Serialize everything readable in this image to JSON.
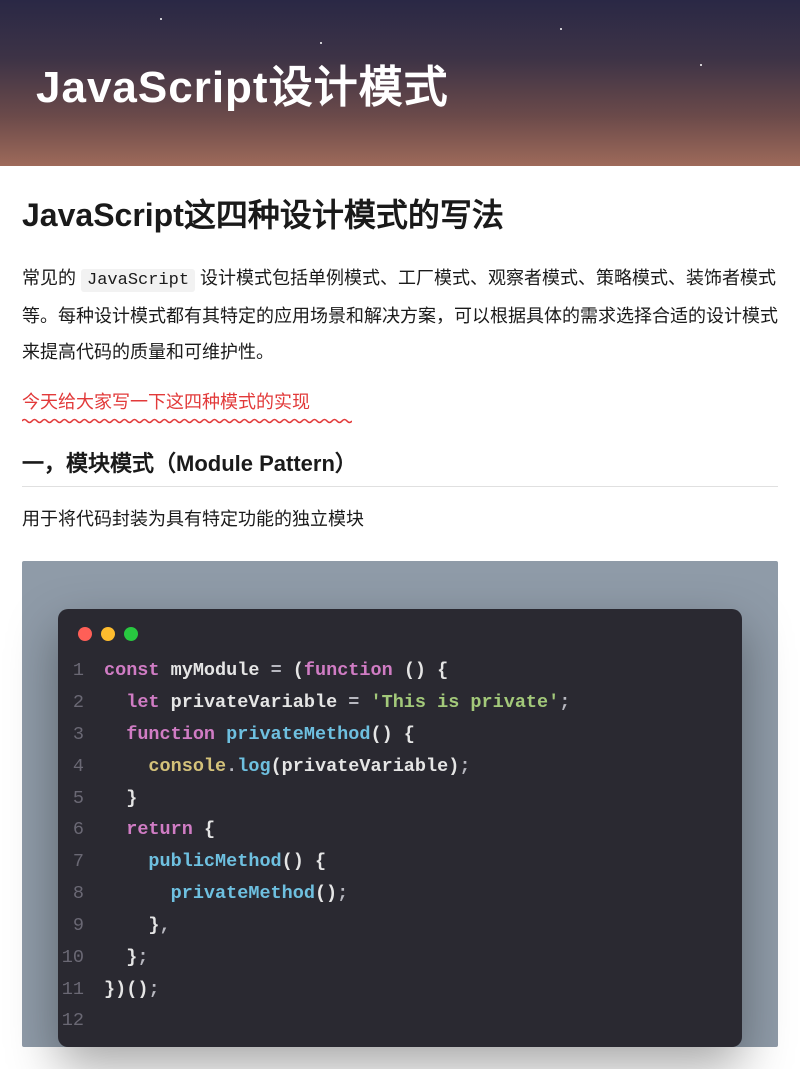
{
  "hero": {
    "title": "JavaScript设计模式"
  },
  "article": {
    "title": "JavaScript这四种设计模式的写法",
    "intro_pre": "常见的 ",
    "intro_code": "JavaScript",
    "intro_post": " 设计模式包括单例模式、工厂模式、观察者模式、策略模式、装饰者模式等。每种设计模式都有其特定的应用场景和解决方案，可以根据具体的需求选择合适的设计模式来提高代码的质量和可维护性。",
    "highlight": "今天给大家写一下这四种模式的实现"
  },
  "section1": {
    "heading": "一，模块模式（Module Pattern）",
    "desc": "用于将代码封装为具有特定功能的独立模块"
  },
  "code": {
    "lines": [
      {
        "n": "1",
        "tokens": [
          [
            "kw",
            "const "
          ],
          [
            "var",
            "myModule"
          ],
          [
            "plain",
            " "
          ],
          [
            "punct",
            "="
          ],
          [
            "plain",
            " "
          ],
          [
            "paren",
            "("
          ],
          [
            "kw",
            "function"
          ],
          [
            "plain",
            " "
          ],
          [
            "paren",
            "()"
          ],
          [
            "plain",
            " "
          ],
          [
            "brace",
            "{"
          ]
        ]
      },
      {
        "n": "2",
        "tokens": [
          [
            "plain",
            "  "
          ],
          [
            "kw",
            "let "
          ],
          [
            "var",
            "privateVariable"
          ],
          [
            "plain",
            " "
          ],
          [
            "punct",
            "="
          ],
          [
            "plain",
            " "
          ],
          [
            "str",
            "'This is private'"
          ],
          [
            "punct",
            ";"
          ]
        ]
      },
      {
        "n": "3",
        "tokens": [
          [
            "plain",
            "  "
          ],
          [
            "kw",
            "function "
          ],
          [
            "fn1",
            "privateMethod"
          ],
          [
            "paren",
            "()"
          ],
          [
            "plain",
            " "
          ],
          [
            "brace",
            "{"
          ]
        ]
      },
      {
        "n": "4",
        "tokens": [
          [
            "plain",
            "    "
          ],
          [
            "obj",
            "console"
          ],
          [
            "punct",
            "."
          ],
          [
            "method",
            "log"
          ],
          [
            "paren",
            "("
          ],
          [
            "var",
            "privateVariable"
          ],
          [
            "paren",
            ")"
          ],
          [
            "punct",
            ";"
          ]
        ]
      },
      {
        "n": "5",
        "tokens": [
          [
            "plain",
            "  "
          ],
          [
            "brace",
            "}"
          ]
        ]
      },
      {
        "n": "6",
        "tokens": [
          [
            "plain",
            "  "
          ],
          [
            "kw",
            "return"
          ],
          [
            "plain",
            " "
          ],
          [
            "brace",
            "{"
          ]
        ]
      },
      {
        "n": "7",
        "tokens": [
          [
            "plain",
            "    "
          ],
          [
            "prop",
            "publicMethod"
          ],
          [
            "paren",
            "()"
          ],
          [
            "plain",
            " "
          ],
          [
            "brace",
            "{"
          ]
        ]
      },
      {
        "n": "8",
        "tokens": [
          [
            "plain",
            "      "
          ],
          [
            "fn2",
            "privateMethod"
          ],
          [
            "paren",
            "()"
          ],
          [
            "punct",
            ";"
          ]
        ]
      },
      {
        "n": "9",
        "tokens": [
          [
            "plain",
            "    "
          ],
          [
            "brace",
            "}"
          ],
          [
            "punct",
            ","
          ]
        ]
      },
      {
        "n": "10",
        "tokens": [
          [
            "plain",
            "  "
          ],
          [
            "brace",
            "}"
          ],
          [
            "punct",
            ";"
          ]
        ]
      },
      {
        "n": "11",
        "tokens": [
          [
            "brace",
            "}"
          ],
          [
            "paren",
            ")"
          ],
          [
            "paren",
            "()"
          ],
          [
            "punct",
            ";"
          ]
        ]
      },
      {
        "n": "12",
        "tokens": []
      }
    ]
  }
}
